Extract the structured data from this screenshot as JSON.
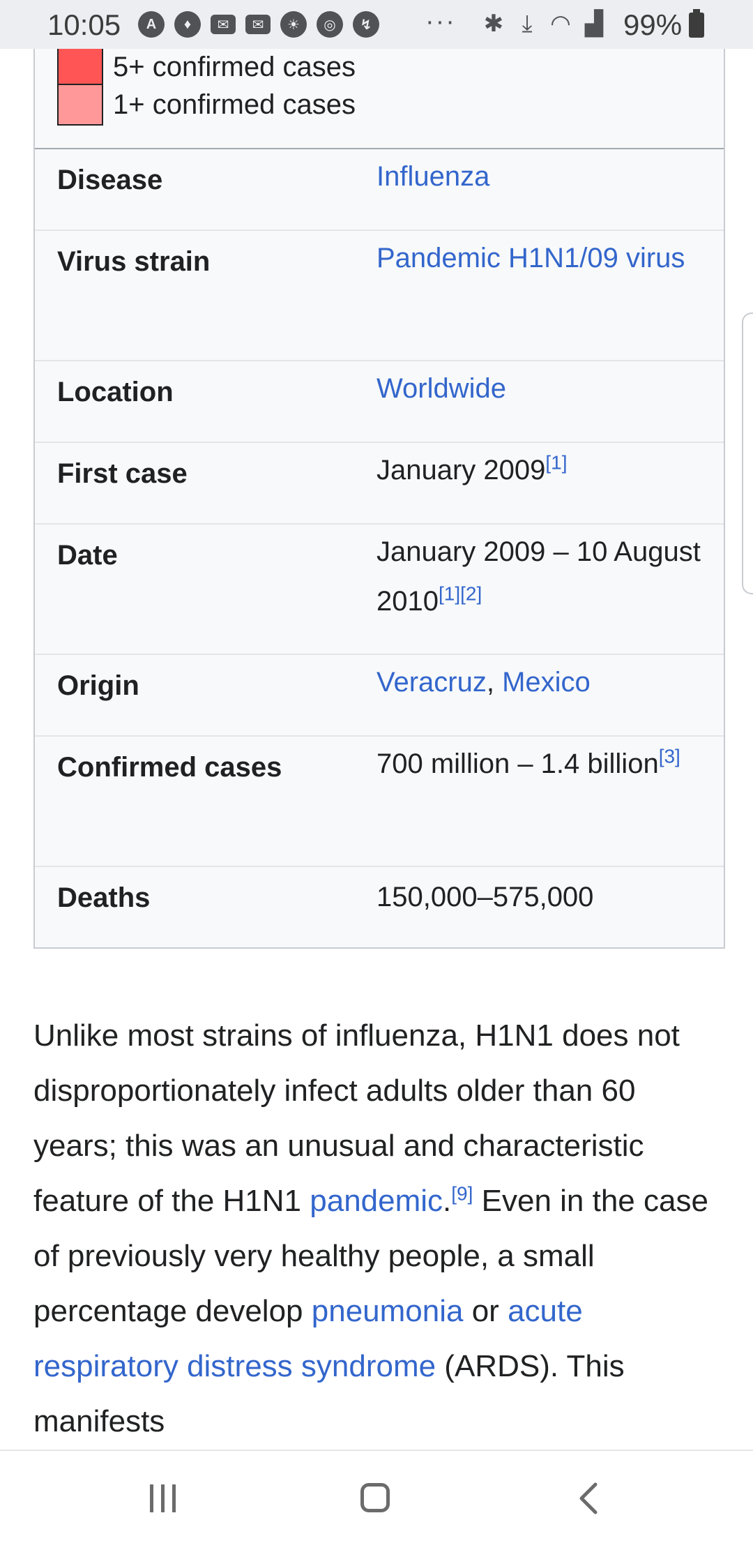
{
  "status_bar": {
    "time": "10:05",
    "left_icons": [
      "amex-icon",
      "tinder-icon",
      "mail-icon",
      "mail-icon",
      "weather-icon",
      "chrome-icon",
      "messenger-icon"
    ],
    "overflow": "···",
    "right_icons": [
      "bluetooth-icon",
      "download-icon",
      "wifi-icon",
      "signal-icon"
    ],
    "battery": "99%"
  },
  "infobox": {
    "legend": [
      {
        "label": "5+ confirmed cases",
        "color": "#ff5555"
      },
      {
        "label": "1+ confirmed cases",
        "color": "#ff9999"
      }
    ],
    "rows": {
      "disease": {
        "key": "Disease",
        "value": "Influenza"
      },
      "virus_strain": {
        "key": "Virus strain",
        "value": "Pandemic H1N1/09 virus"
      },
      "location": {
        "key": "Location",
        "value": "Worldwide"
      },
      "first_case": {
        "key": "First case",
        "value": "January 2009",
        "ref": "[1]"
      },
      "date": {
        "key": "Date",
        "value": "January 2009 – 10 August 2010",
        "ref1": "[1]",
        "ref2": "[2]"
      },
      "origin": {
        "key": "Origin",
        "value1": "Veracruz",
        "sep": ", ",
        "value2": "Mexico"
      },
      "confirmed_cases": {
        "key": "Confirmed cases",
        "value": "700 million – 1.4 billion",
        "ref": "[3]"
      },
      "deaths": {
        "key": "Deaths",
        "value": "150,000–575,000"
      }
    }
  },
  "article": {
    "p1": "Unlike most strains of influenza, H1N1 does not disproportionately infect adults older than 60 years; this was an unusual and characteristic feature of the H1N1 ",
    "link_pandemic": "pandemic",
    "p2": ".",
    "ref9": "[9]",
    "p3": " Even in the case of previously very healthy people, a small percentage develop ",
    "link_pneumonia": "pneumonia",
    "p4": " or ",
    "link_ards": "acute respiratory distress syndrome",
    "p5": " (ARDS). This manifests"
  },
  "nav_bar": {
    "buttons": [
      "recent-apps",
      "home",
      "back"
    ]
  },
  "colors": {
    "link": "#3366cc",
    "infobox_bg": "#f8f9fa",
    "status_bar_bg": "#eceef1"
  }
}
